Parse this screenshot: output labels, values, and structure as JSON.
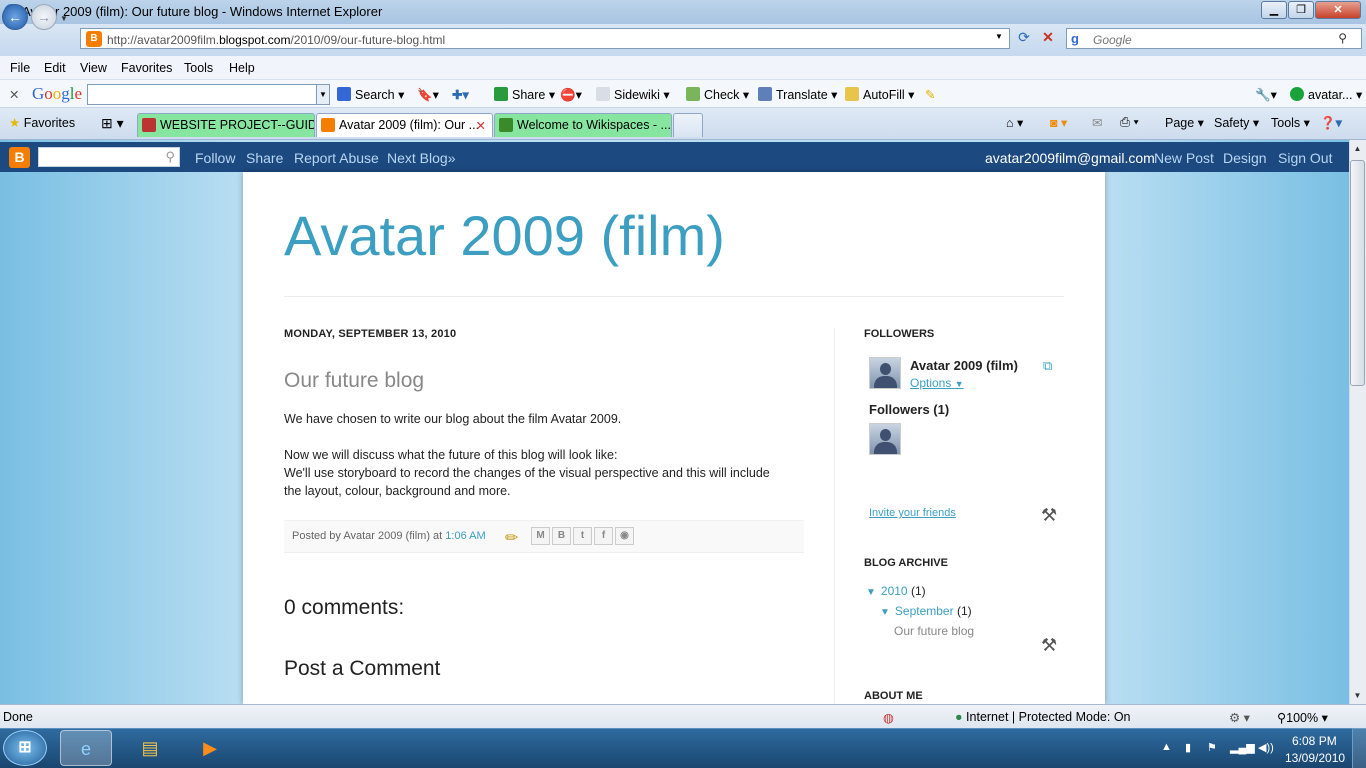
{
  "window": {
    "title": "Avatar 2009 (film): Our future blog - Windows Internet Explorer",
    "min": "▁",
    "max": "❐",
    "close": "✕"
  },
  "address": {
    "url_prefix": "http://avatar2009film.",
    "url_domain": "blogspot.com",
    "url_path": "/2010/09/our-future-blog.html",
    "search_placeholder": "Google"
  },
  "menu": {
    "file": "File",
    "edit": "Edit",
    "view": "View",
    "favorites": "Favorites",
    "tools": "Tools",
    "help": "Help"
  },
  "google_toolbar": {
    "close": "✕",
    "logo": "Google",
    "search": "Search",
    "share": "Share",
    "sidewiki": "Sidewiki",
    "check": "Check",
    "translate": "Translate",
    "autofill": "AutoFill",
    "account": "avatar..."
  },
  "favbar": {
    "favorites": "Favorites",
    "tabs": [
      {
        "label": "WEBSITE PROJECT--GUIDE..."
      },
      {
        "label": "Avatar 2009 (film): Our ..."
      },
      {
        "label": "Welcome to Wikispaces - ..."
      }
    ],
    "page": "Page",
    "safety": "Safety",
    "tools": "Tools"
  },
  "blogger_nav": {
    "follow": "Follow",
    "share": "Share",
    "report_abuse": "Report Abuse",
    "next_blog": "Next Blog»",
    "email": "avatar2009film@gmail.com",
    "new_post": "New Post",
    "design": "Design",
    "sign_out": "Sign Out"
  },
  "blog": {
    "title": "Avatar 2009 (film)",
    "date_header": "MONDAY, SEPTEMBER 13, 2010",
    "post_title": "Our future blog",
    "post_lines": [
      "We have chosen to write our blog about the film Avatar 2009.",
      "Now we will discuss what the future of this blog will look like:",
      "We'll use storyboard to record the changes of the visual perspective and this will include",
      "the layout, colour, background and more."
    ],
    "posted_by_prefix": "Posted by",
    "author": "Avatar 2009 (film)",
    "at": "at",
    "time": "1:06 AM",
    "comments_heading": "0 comments:",
    "post_comment_heading": "Post a Comment"
  },
  "sidebar": {
    "followers_heading": "FOLLOWERS",
    "follower_name": "Avatar 2009 (film)",
    "options": "Options",
    "followers_count": "Followers (1)",
    "invite": "Invite your friends",
    "archive_heading": "BLOG ARCHIVE",
    "archive_year": "2010",
    "archive_year_count": "(1)",
    "archive_month": "September",
    "archive_month_count": "(1)",
    "archive_post": "Our future blog",
    "about_heading": "ABOUT ME"
  },
  "status": {
    "done": "Done",
    "zone": "Internet | Protected Mode: On",
    "zoom": "100%"
  },
  "taskbar": {
    "time": "6:08 PM",
    "date": "13/09/2010"
  },
  "colors": {
    "blog_title": "#3c9fc2",
    "nav_bar": "#1c4a80",
    "tab_highlight": "#86e6a0"
  }
}
